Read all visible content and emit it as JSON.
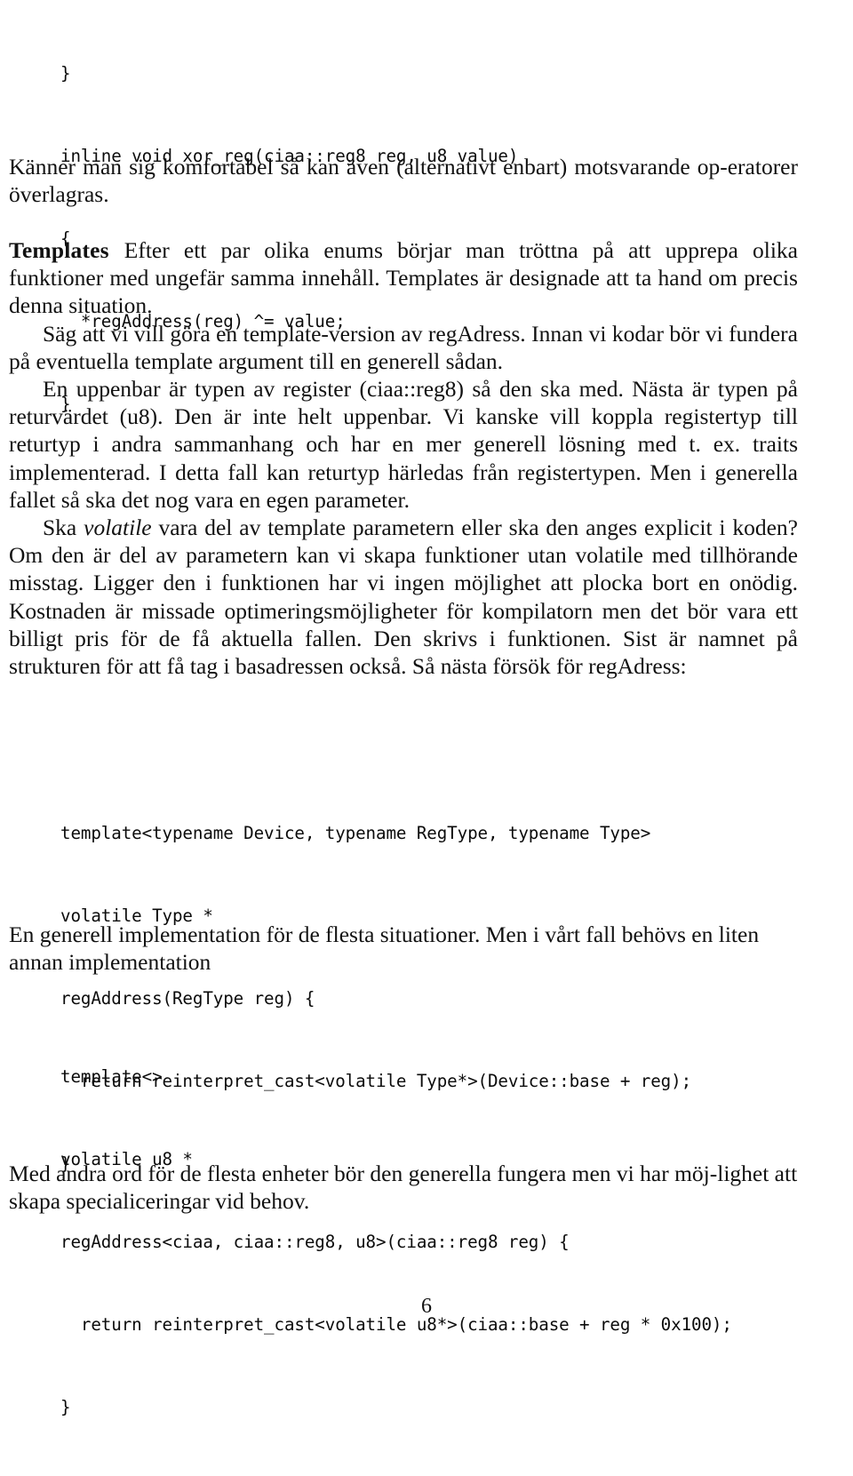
{
  "document": {
    "page_number": "6",
    "language": "sv"
  },
  "code_blocks": [
    {
      "id": "xor-reg-snippet",
      "lines": [
        "}",
        "inline void xor_reg(ciaa::reg8 reg, u8 value)",
        "{",
        "  *regAddress(reg) ^= value;",
        "}"
      ]
    },
    {
      "id": "generic-regaddress-template",
      "lines": [
        "template<typename Device, typename RegType, typename Type>",
        "volatile Type *",
        "regAddress(RegType reg) {",
        "  return reinterpret_cast<volatile Type*>(Device::base + reg);",
        "}"
      ]
    },
    {
      "id": "regaddress-specialization",
      "lines": [
        "template<>",
        "volatile u8 *",
        "regAddress<ciaa, ciaa::reg8, u8>(ciaa::reg8 reg) {",
        "  return reinterpret_cast<volatile u8*>(ciaa::base + reg * 0x100);",
        "}"
      ]
    }
  ],
  "paragraphs": {
    "komfortabel": "Känner man sig komfortabel så kan även (alternativt enbart) motsvarande op-eratorer överlagras.",
    "templates_heading": "Templates",
    "templates_body": "Efter ett par olika enums börjar man tröttna på att upprepa olika funktioner med ungefär samma innehåll. Templates är designade att ta hand om precis denna situation.",
    "sag_att": "Säg att vi vill göra en template-version av regAdress. Innan vi kodar bör vi fundera på eventuella template argument till en generell sådan.",
    "en_uppenbar": "En uppenbar är typen av register (ciaa::reg8) så den ska med. Nästa är typen på returvärdet (u8). Den är inte helt uppenbar. Vi kanske vill koppla registertyp till returtyp i andra sammanhang och har en mer generell lösning med t. ex. traits implementerad. I detta fall kan returtyp härledas från registertypen. Men i generella fallet så ska det nog vara en egen parameter.",
    "ska_volatile_pre": "Ska ",
    "ska_volatile_emph": "volatile",
    "ska_volatile_post": " vara del av template parametern eller ska den anges explicit i koden? Om den är del av parametern kan vi skapa funktioner utan volatile med tillhörande misstag. Ligger den i funktionen har vi ingen möjlighet att plocka bort en onödig. Kostnaden är missade optimeringsmöjligheter för kompilatorn men det bör vara ett billigt pris för de få aktuella fallen. Den skrivs i funktionen. Sist är namnet på strukturen för att få tag i basadressen också. Så nästa försök för regAdress:",
    "en_generell": "En generell implementation för de flesta situationer. Men i vårt fall behövs en liten annan implementation",
    "med_andra_ord": "Med andra ord för de flesta enheter bör den generella fungera men vi har möj-lighet att skapa specialiceringar vid behov."
  }
}
